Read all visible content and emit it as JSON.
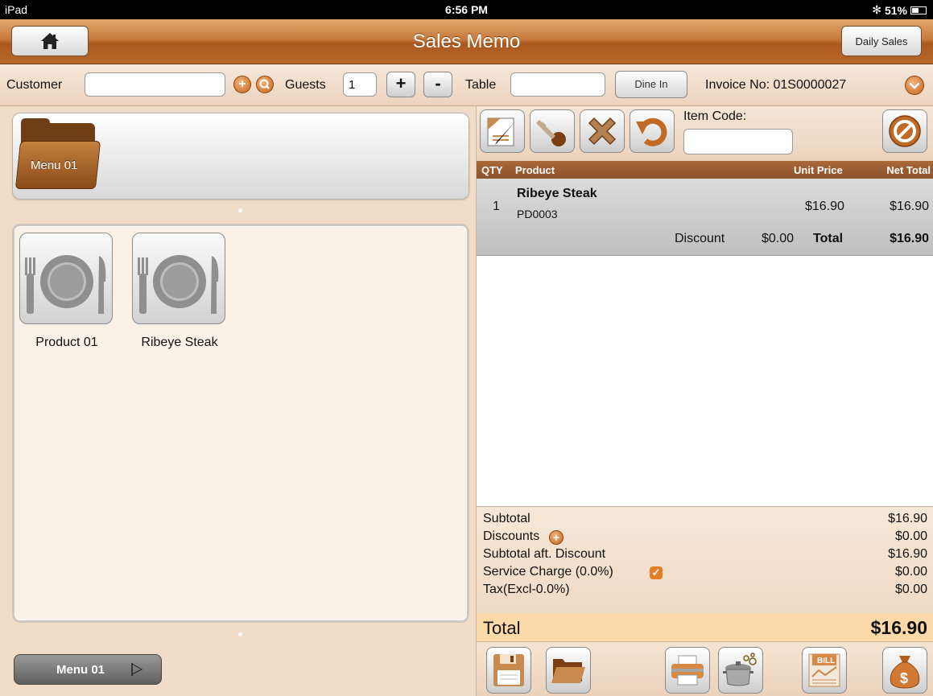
{
  "status_bar": {
    "device": "iPad",
    "time": "6:56 PM",
    "battery": "51%",
    "battery_level": 0.51
  },
  "nav": {
    "title": "Sales Memo",
    "daily_sales_label": "Daily Sales",
    "home_icon": "house-icon"
  },
  "customer_bar": {
    "customer_label": "Customer",
    "customer_value": "",
    "guests_label": "Guests",
    "guests_value": "1",
    "plus_label": "+",
    "minus_label": "-",
    "table_label": "Table",
    "table_value": "",
    "dine_in_label": "Dine In",
    "invoice_label": "Invoice No: 01S0000027"
  },
  "menus": {
    "folder_label": "Menu 01",
    "tab_label": "Menu 01"
  },
  "products": [
    {
      "name": "Product 01",
      "icon": "plate-cutlery-icon"
    },
    {
      "name": "Ribeye Steak",
      "icon": "plate-cutlery-icon"
    }
  ],
  "order": {
    "item_code_label": "Item Code:",
    "item_code_value": "",
    "columns": {
      "qty": "QTY",
      "product": "Product",
      "unit_price": "Unit Price",
      "net_total": "Net Total"
    },
    "items": [
      {
        "qty": "1",
        "product": "Ribeye Steak",
        "code": "PD0003",
        "unit_price": "$16.90",
        "net_total": "$16.90",
        "discount_label": "Discount",
        "discount_value": "$0.00",
        "total_label": "Total",
        "total_value": "$16.90"
      }
    ]
  },
  "totals": {
    "subtotal_label": "Subtotal",
    "subtotal": "$16.90",
    "discounts_label": "Discounts",
    "discounts": "$0.00",
    "subtotal_after_label": "Subtotal aft. Discount",
    "subtotal_after": "$16.90",
    "service_label": "Service Charge (0.0%)",
    "service": "$0.00",
    "tax_label": "Tax(Excl-0.0%)",
    "tax": "$0.00",
    "grand_label": "Total",
    "grand": "$16.90"
  },
  "colors": {
    "accent": "#c4661e",
    "nav": "#b8682b",
    "header": "#8c522a"
  }
}
